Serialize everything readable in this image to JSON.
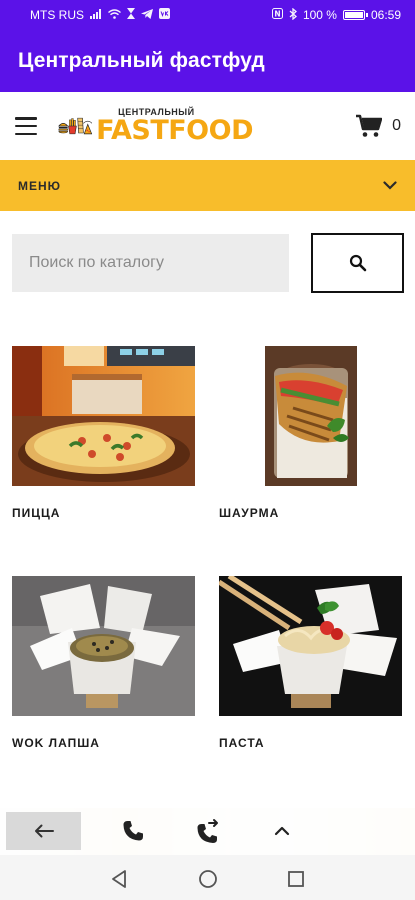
{
  "status_bar": {
    "carrier": "MTS RUS",
    "left_icons": [
      "signal-icon",
      "wifi-icon",
      "hourglass-icon",
      "telegram-icon",
      "vk-icon"
    ],
    "nfc_label": "N",
    "battery_percent": "100 %",
    "time": "06:59"
  },
  "app_bar": {
    "title": "Центральный фастфуд"
  },
  "header": {
    "logo_small_text": "ЦЕНТРАЛЬНЫЙ",
    "logo_big_text": "FASTFOOD",
    "cart_count": "0"
  },
  "menu_bar": {
    "label": "МЕНЮ"
  },
  "search": {
    "placeholder": "Поиск по каталогу",
    "value": ""
  },
  "catalog": {
    "items": [
      {
        "name": "ПИЦЦА"
      },
      {
        "name": "ШАУРМА"
      },
      {
        "name": "WOK ЛАПША"
      },
      {
        "name": "ПАСТА"
      }
    ]
  },
  "colors": {
    "primary": "#5b12e8",
    "accent": "#f8bd2b",
    "logo_orange": "#f5a713"
  }
}
